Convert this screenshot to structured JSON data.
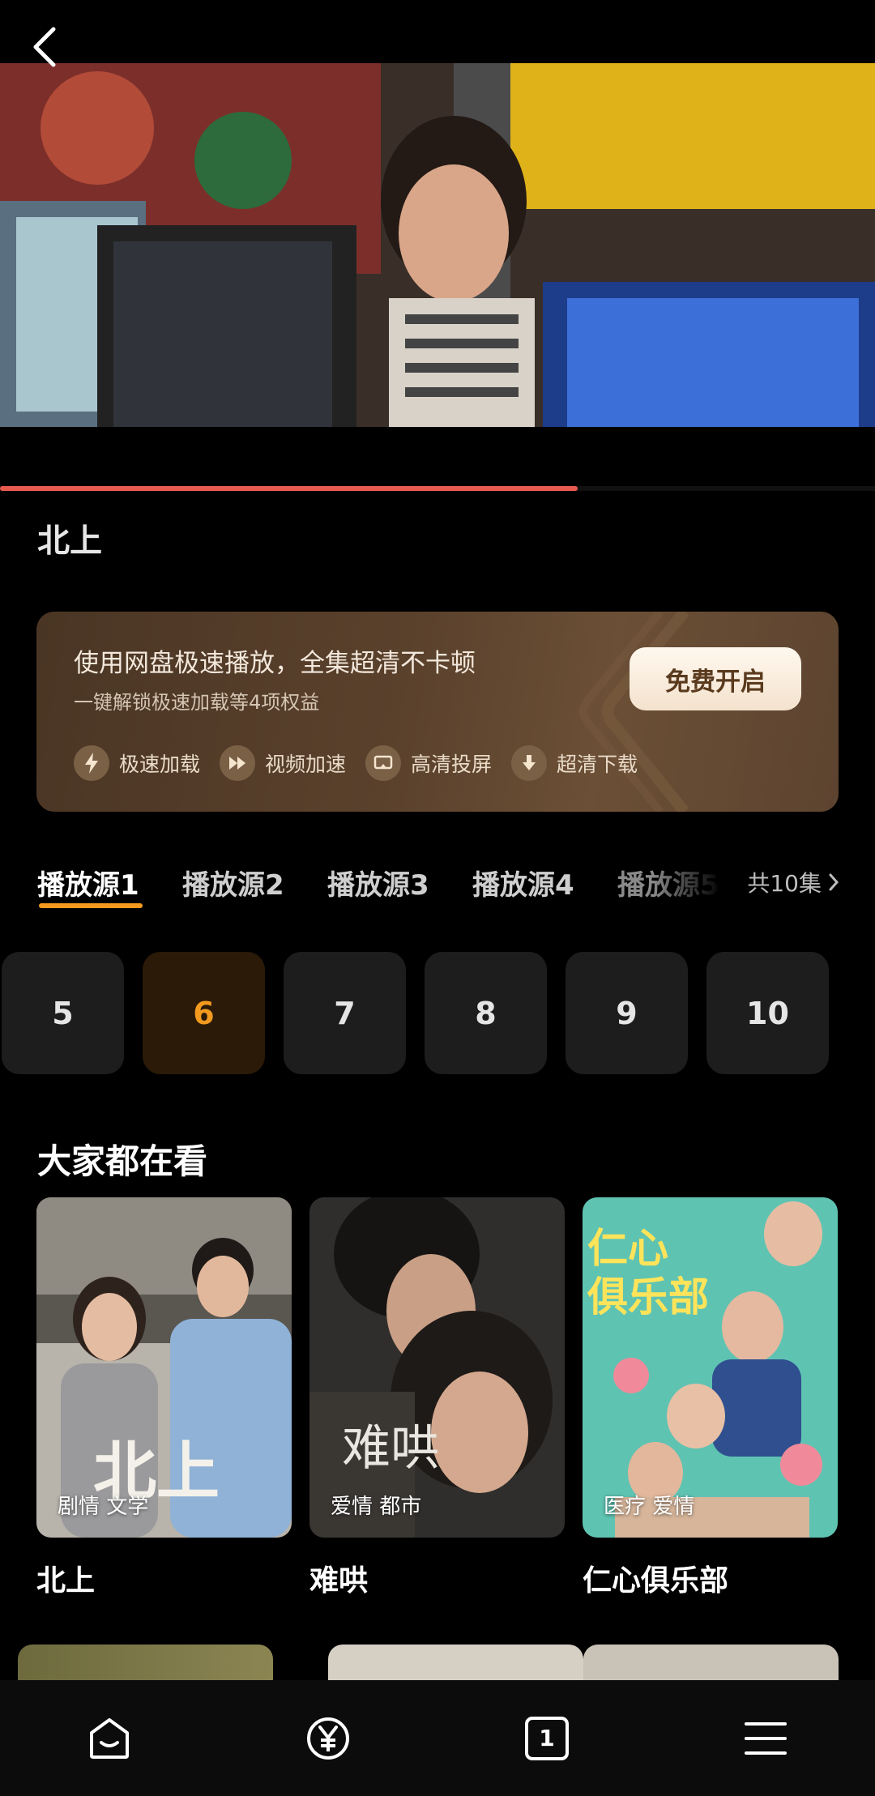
{
  "video": {
    "title": "北上",
    "progress": 0.66
  },
  "promo": {
    "headline": "使用网盘极速播放，全集超清不卡顿",
    "subline": "一键解锁极速加载等4项权益",
    "cta_label": "免费开启",
    "perks": [
      {
        "icon": "lightning-icon",
        "label": "极速加载"
      },
      {
        "icon": "play-speed-icon",
        "label": "视频加速"
      },
      {
        "icon": "cast-screen-icon",
        "label": "高清投屏"
      },
      {
        "icon": "download-icon",
        "label": "超清下载"
      }
    ]
  },
  "sources": {
    "tabs": [
      "播放源1",
      "播放源2",
      "播放源3",
      "播放源4",
      "播放源5"
    ],
    "active_index": 0,
    "episode_count_label": "共10集"
  },
  "episodes": {
    "items": [
      "5",
      "6",
      "7",
      "8",
      "9",
      "10"
    ],
    "active": "6"
  },
  "recommend": {
    "title": "大家都在看",
    "items": [
      {
        "name": "北上",
        "tags": "剧情 文学"
      },
      {
        "name": "难哄",
        "tags": "爱情 都市"
      },
      {
        "name": "仁心俱乐部",
        "tags": "医疗 爱情"
      }
    ]
  },
  "bottom_nav": [
    {
      "icon": "home-icon"
    },
    {
      "icon": "yuan-coin-icon"
    },
    {
      "icon": "tab-count-icon",
      "label": "1"
    },
    {
      "icon": "menu-icon"
    }
  ],
  "colors": {
    "accent": "#f39a1f",
    "progress": "#e85a4f",
    "promo_bg": "#5a412c"
  }
}
